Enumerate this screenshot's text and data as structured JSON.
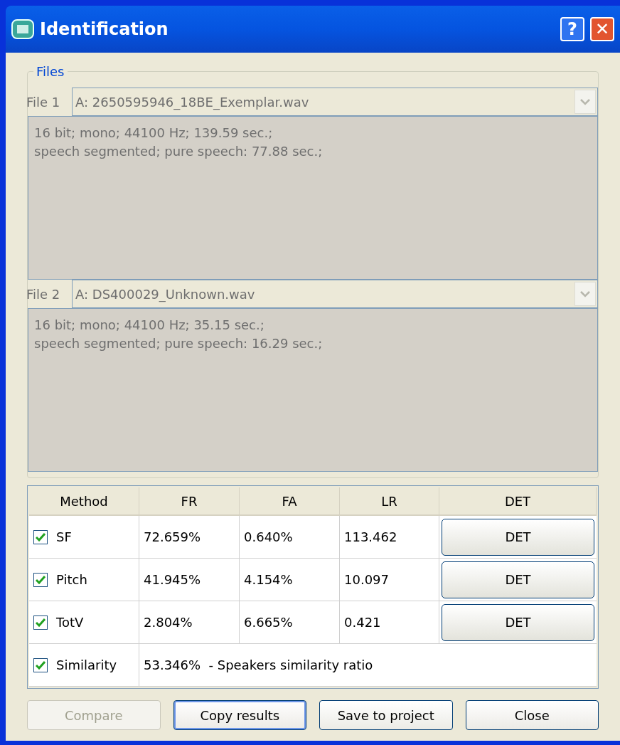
{
  "window": {
    "title": "Identification",
    "title_buttons": [
      "?",
      "✕"
    ]
  },
  "files_group": {
    "title": "Files",
    "files": [
      {
        "label": "File 1",
        "value": "A: 2650595946_18BE_Exemplar.wav",
        "disabled": true,
        "info": [
          "16 bit; mono; 44100 Hz; 139.59 sec.;",
          "speech segmented;  pure speech: 77.88 sec.;"
        ]
      },
      {
        "label": "File 2",
        "value": "A: DS400029_Unknown.wav",
        "disabled": true,
        "info": [
          "16 bit; mono; 44100 Hz; 35.15 sec.;",
          "speech segmented;  pure speech: 16.29 sec.;"
        ]
      }
    ]
  },
  "table": {
    "columns": [
      "Method",
      "FR",
      "FA",
      "LR",
      "DET"
    ],
    "rows": [
      {
        "kind": "metric",
        "checked": true,
        "method": "SF",
        "fr": "72.659%",
        "fa": "0.640%",
        "lr": "113.462",
        "det": "DET"
      },
      {
        "kind": "metric",
        "checked": true,
        "method": "Pitch",
        "fr": "41.945%",
        "fa": "4.154%",
        "lr": "10.097",
        "det": "DET"
      },
      {
        "kind": "metric",
        "checked": true,
        "method": "TotV",
        "fr": "2.804%",
        "fa": "6.665%",
        "lr": "0.421",
        "det": "DET"
      },
      {
        "kind": "summary",
        "checked": true,
        "method": "Similarity",
        "summary": "53.346%  - Speakers similarity ratio"
      }
    ]
  },
  "buttons": [
    {
      "label": "Compare",
      "disabled": true,
      "focused": false
    },
    {
      "label": "Copy results",
      "disabled": false,
      "focused": true
    },
    {
      "label": "Save to project",
      "disabled": false,
      "focused": false
    },
    {
      "label": "Close",
      "disabled": false,
      "focused": false
    }
  ]
}
